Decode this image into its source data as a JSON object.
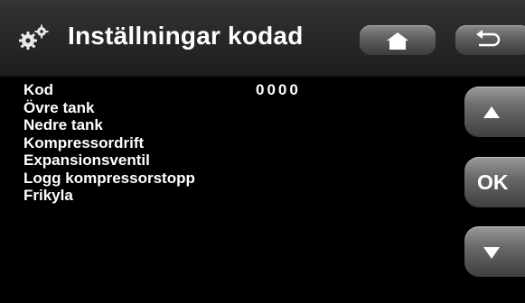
{
  "header": {
    "title": "Inställningar kodad",
    "icons": {
      "settings": "gears-icon",
      "home": "home-icon",
      "back": "back-arrow-icon"
    }
  },
  "settings_list": [
    {
      "label": "Kod",
      "value": "0000"
    },
    {
      "label": "Övre tank",
      "value": ""
    },
    {
      "label": "Nedre tank",
      "value": ""
    },
    {
      "label": "Kompressordrift",
      "value": ""
    },
    {
      "label": "Expansionsventil",
      "value": ""
    },
    {
      "label": "Logg kompressorstopp",
      "value": ""
    },
    {
      "label": "Frikyla",
      "value": ""
    }
  ],
  "side_buttons": {
    "up": "up-arrow-icon",
    "ok_label": "OK",
    "down": "down-arrow-icon"
  },
  "colors": {
    "background": "#000000",
    "header": "#2a2a2a",
    "text": "#ffffff",
    "button": "#6a6a6a"
  }
}
